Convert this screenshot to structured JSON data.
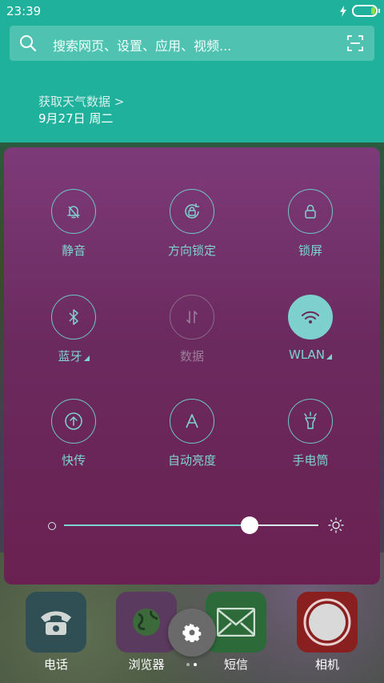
{
  "status": {
    "time": "23:39"
  },
  "search": {
    "placeholder": "搜索网页、设置、应用、视频..."
  },
  "weather": {
    "link": "获取天气数据 >",
    "date": "9月27日 周二"
  },
  "tiles": [
    {
      "label": "静音",
      "icon": "bell-off-icon",
      "state": "off"
    },
    {
      "label": "方向锁定",
      "icon": "rotation-lock-icon",
      "state": "off"
    },
    {
      "label": "锁屏",
      "icon": "lock-icon",
      "state": "off"
    },
    {
      "label": "蓝牙",
      "icon": "bluetooth-icon",
      "state": "off",
      "expand": true
    },
    {
      "label": "数据",
      "icon": "data-arrows-icon",
      "state": "disabled"
    },
    {
      "label": "WLAN",
      "icon": "wifi-icon",
      "state": "on",
      "expand": true
    },
    {
      "label": "快传",
      "icon": "upload-icon",
      "state": "off"
    },
    {
      "label": "自动亮度",
      "icon": "auto-brightness-icon",
      "state": "off"
    },
    {
      "label": "手电筒",
      "icon": "flashlight-icon",
      "state": "off"
    }
  ],
  "brightness": {
    "level": 0.73
  },
  "dock": [
    {
      "label": "电话",
      "icon": "phone-icon",
      "color": "#2f4f55"
    },
    {
      "label": "浏览器",
      "icon": "globe-icon",
      "color": "#5a3a5e"
    },
    {
      "label": "短信",
      "icon": "mail-icon",
      "color": "#2c6a3a"
    },
    {
      "label": "相机",
      "icon": "camera-icon",
      "color": "#8a1f1f"
    }
  ],
  "colors": {
    "accent": "#1fb19c",
    "tile": "#7fd3cf",
    "panel": "#6b2a5e"
  }
}
